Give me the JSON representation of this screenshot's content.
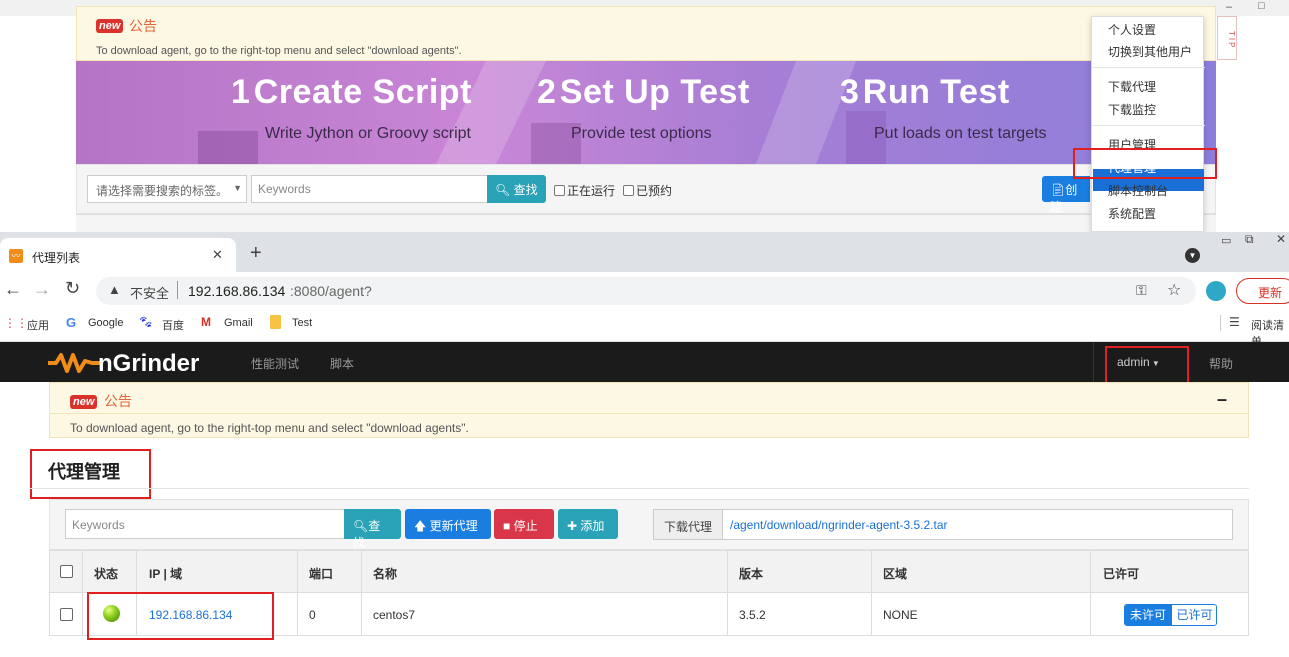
{
  "top_screenshot": {
    "announcement": {
      "badge": "new",
      "title": "公告",
      "text": "To download agent, go to the right-top menu and select \"download agents\"."
    },
    "banner": {
      "steps": [
        {
          "num": "1",
          "title": "Create Script",
          "desc": "Write Jython or Groovy script"
        },
        {
          "num": "2",
          "title": "Set Up Test",
          "desc": "Provide test options"
        },
        {
          "num": "3",
          "title": "Run Test",
          "desc": "Put loads on test targets"
        }
      ]
    },
    "search": {
      "tag_select": "请选择需要搜索的标签。",
      "keywords_placeholder": "Keywords",
      "search_btn": "查找",
      "running_label": "正在运行",
      "scheduled_label": "已预约",
      "create_btn": "创建"
    },
    "tip": "TIP",
    "user_menu": {
      "items": [
        "个人设置",
        "切换到其他用户",
        "下载代理",
        "下载监控",
        "用户管理",
        "代理管理",
        "脚本控制台",
        "系统配置"
      ],
      "active": "代理管理"
    }
  },
  "browser": {
    "tab_title": "代理列表",
    "new_tab": "+",
    "insecure_label": "不安全",
    "url_host": "192.168.86.134",
    "url_rest": ":8080/agent?",
    "update_btn": "更新",
    "bookmarks": [
      "应用",
      "Google",
      "百度",
      "Gmail",
      "Test"
    ],
    "reading_list": "阅读清单"
  },
  "nav": {
    "logo": "nGrinder",
    "links": [
      "性能测试",
      "脚本"
    ],
    "user": "admin",
    "help": "帮助"
  },
  "announcement": {
    "badge": "new",
    "title": "公告",
    "collapse": "–",
    "text": "To download agent, go to the right-top menu and select \"download agents\"."
  },
  "page_title": "代理管理",
  "toolbar": {
    "keywords_placeholder": "Keywords",
    "search_btn": "查找",
    "update_btn": "更新代理",
    "stop_btn": "停止",
    "add_btn": "添加",
    "download_label": "下载代理",
    "download_link": "/agent/download/ngrinder-agent-3.5.2.tar"
  },
  "table": {
    "headers": [
      "状态",
      "IP | 域",
      "端口",
      "名称",
      "版本",
      "区域",
      "已许可"
    ],
    "rows": [
      {
        "status": "green",
        "ip": "192.168.86.134",
        "port": "0",
        "name": "centos7",
        "version": "3.5.2",
        "region": "NONE",
        "unapprove": "未许可",
        "approve": "已许可"
      }
    ]
  },
  "colors": {
    "accent": "#1a7ee0",
    "info": "#2aa3b8",
    "danger": "#d9364a",
    "highlight": "#e02020",
    "nav": "#1b1b1b",
    "logo": "#f08c1a"
  }
}
